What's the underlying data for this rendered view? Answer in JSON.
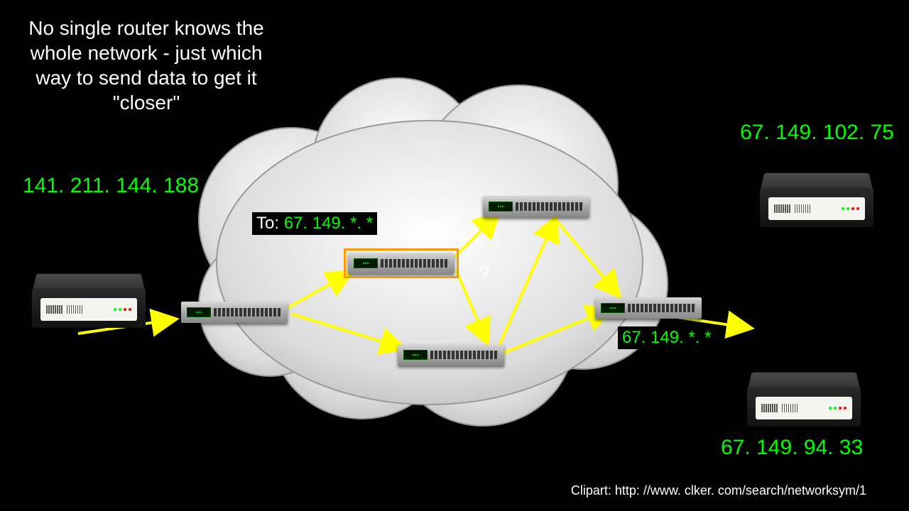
{
  "title": "No single router knows the whole network - just which way to send data to get it \"closer\"",
  "ips": {
    "top_right": "67. 149. 102. 75",
    "left": "141. 211. 144. 188",
    "bottom_right": "67. 149. 94. 33"
  },
  "routing": {
    "to_prefix": "To: ",
    "to_value": "67. 149. *. *",
    "mid_value": "67. 149. *. *"
  },
  "questions": {
    "q1": "?",
    "q2": "?"
  },
  "clipart_credit": "Clipart: http: //www. clker. com/search/networksym/1",
  "colors": {
    "ip_green": "#00ff00",
    "arrow_yellow": "#ffff00",
    "highlight_orange": "#ff9900",
    "bg": "#000000"
  }
}
